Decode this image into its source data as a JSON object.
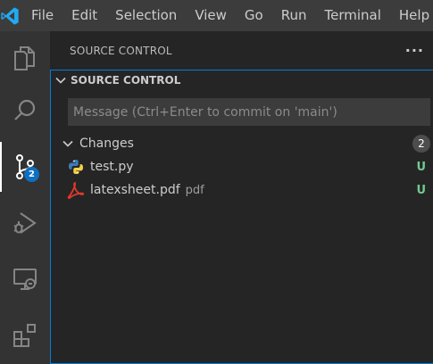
{
  "menu": [
    "File",
    "Edit",
    "Selection",
    "View",
    "Go",
    "Run",
    "Terminal",
    "Help"
  ],
  "activity": {
    "scm_badge": "2"
  },
  "sidebar": {
    "title": "SOURCE CONTROL",
    "more": "···",
    "section_title": "SOURCE CONTROL",
    "message_placeholder": "Message (Ctrl+Enter to commit on 'main')",
    "changes_label": "Changes",
    "changes_count": "2",
    "files": [
      {
        "name": "test.py",
        "desc": "",
        "status": "U",
        "icon": "python-icon"
      },
      {
        "name": "latexsheet.pdf",
        "desc": "pdf",
        "status": "U",
        "icon": "pdf-icon"
      }
    ]
  },
  "colors": {
    "accent": "#0e70c0",
    "untracked": "#73c991",
    "focus_border": "#007fd4"
  }
}
